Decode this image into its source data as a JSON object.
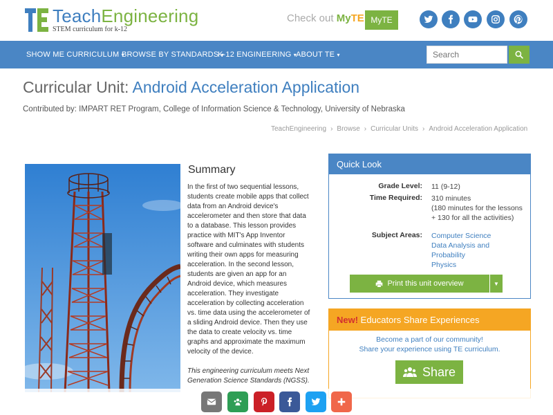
{
  "header": {
    "logo_word_a": "Teach",
    "logo_word_b": "Engineering",
    "tagline": "STEM curriculum for k-12",
    "checkout_prefix": "Check out ",
    "checkout_my": "My",
    "checkout_te": "TE",
    "myte_button": "MyTE",
    "social": [
      "twitter-icon",
      "facebook-icon",
      "youtube-icon",
      "instagram-icon",
      "pinterest-icon"
    ]
  },
  "nav": {
    "items": [
      {
        "label": "SHOW ME CURRICULUM"
      },
      {
        "label": "BROWSE BY STANDARDS"
      },
      {
        "label": "K-12 ENGINEERING"
      },
      {
        "label": "ABOUT TE"
      }
    ],
    "search_placeholder": "Search"
  },
  "page": {
    "title_prefix": "Curricular Unit: ",
    "title_main": "Android Acceleration Application",
    "contributed": "Contributed by: IMPART RET Program, College of Information Science & Technology, University of Nebraska",
    "breadcrumb": [
      "TeachEngineering",
      "Browse",
      "Curricular Units",
      "Android Acceleration Application"
    ]
  },
  "summary": {
    "heading": "Summary",
    "body": "In the first of two sequential lessons, students create mobile apps that collect data from an Android device's accelerometer and then store that data to a database. This lesson provides practice with MIT's App Inventor software and culminates with students writing their own apps for measuring acceleration. In the second lesson, students are given an app for an Android device, which measures acceleration. They investigate acceleration by collecting acceleration vs. time data using the accelerometer of a sliding Android device. Then they use the data to create velocity vs. time graphs and approximate the maximum velocity of the device.",
    "note": "This engineering curriculum meets Next Generation Science Standards (NGSS)."
  },
  "quick_look": {
    "heading": "Quick Look",
    "grade_label": "Grade Level:",
    "grade_value": "11 (9-12)",
    "time_label": "Time Required:",
    "time_lines": [
      "310 minutes",
      "(180 minutes for the lessons",
      "+ 130 for all the activities)"
    ],
    "subject_label": "Subject Areas:",
    "subjects": [
      "Computer Science",
      "Data Analysis and",
      "Probability",
      "Physics"
    ],
    "print_button": "Print this unit overview"
  },
  "educators": {
    "new_tag": "New!",
    "heading": " Educators Share Experiences",
    "line1": "Become a part of our community!",
    "line2": "Share your experience using TE curriculum.",
    "share_button": "Share"
  },
  "share_bar": [
    "email-icon",
    "google-classroom-icon",
    "pinterest-icon",
    "facebook-icon",
    "twitter-icon",
    "plus-icon"
  ],
  "colors": {
    "brand_blue": "#4a86c5",
    "brand_green": "#7cb342",
    "orange": "#f5a623"
  }
}
